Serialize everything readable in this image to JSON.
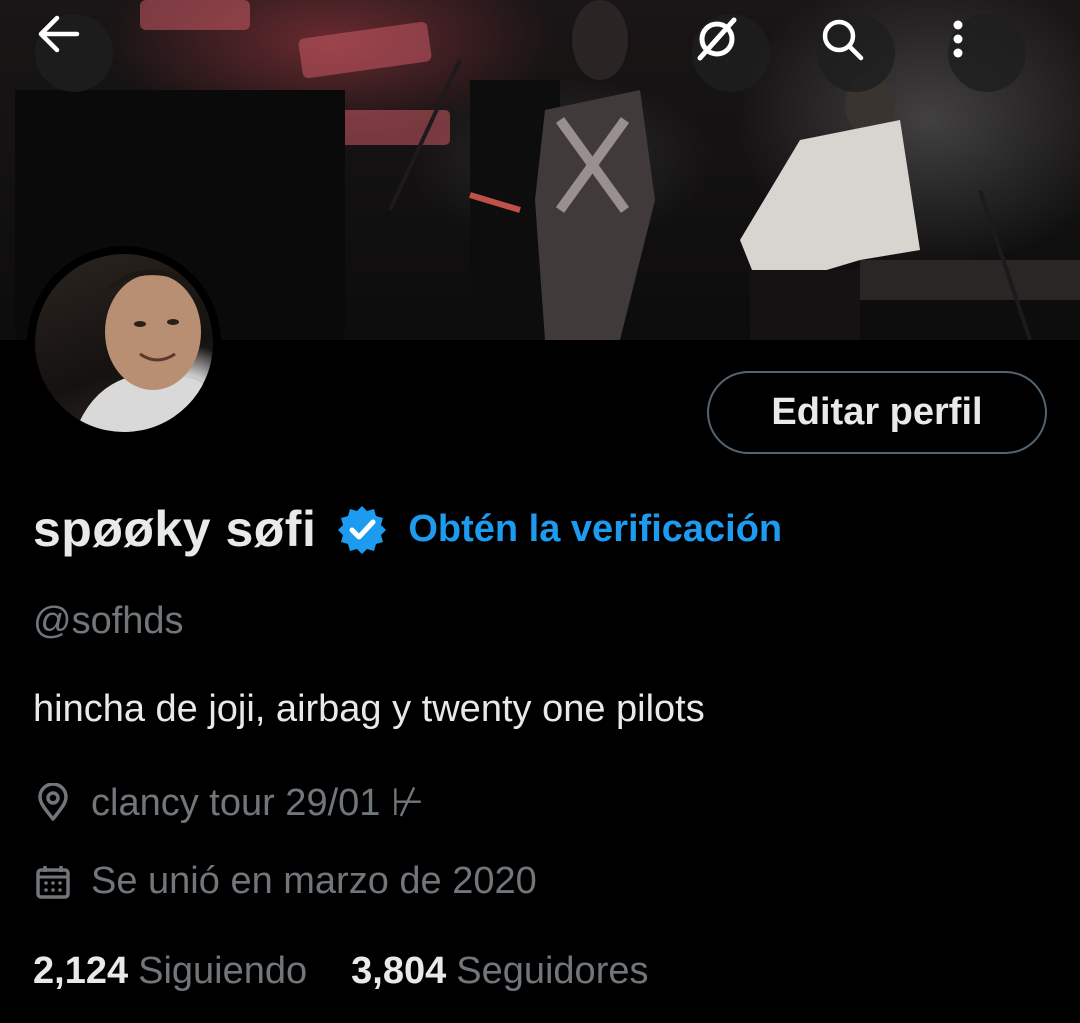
{
  "header": {
    "back_icon": "arrow-left-icon",
    "grok_icon": "grok-icon",
    "search_icon": "search-icon",
    "more_icon": "more-vertical-icon"
  },
  "banner": {
    "description_icon": "concert-photo"
  },
  "profile": {
    "display_name": "spøøky søfi",
    "verify_cta": "Obtén la verificación",
    "handle": "@sofhds",
    "bio": "hincha de joji, airbag y twenty one pilots",
    "location": "clancy tour 29/01 ⊬",
    "joined": "Se unió en marzo de 2020",
    "edit_button": "Editar perfil"
  },
  "stats": {
    "following_count": "2,124",
    "following_label": "Siguiendo",
    "followers_count": "3,804",
    "followers_label": "Seguidores"
  },
  "colors": {
    "accent": "#1d9bf0",
    "muted": "#71767b",
    "text": "#e7e9ea",
    "background": "#000000"
  }
}
